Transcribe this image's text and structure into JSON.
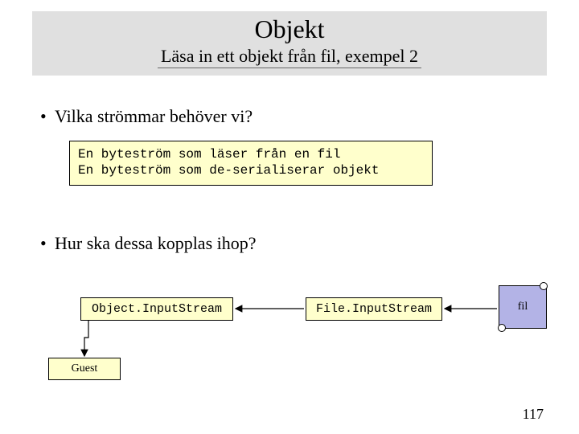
{
  "title": {
    "main": "Objekt",
    "sub": "Läsa in ett objekt från fil, exempel 2"
  },
  "bullets": {
    "b1": "Vilka strömmar behöver vi?",
    "b2": "Hur ska dessa kopplas ihop?"
  },
  "code": {
    "line1": "En byteström som läser från en fil",
    "line2": "En byteström som de-serialiserar objekt"
  },
  "diagram": {
    "ois": "Object.InputStream",
    "fis": "File.InputStream",
    "file": "fil",
    "guest": "Guest"
  },
  "page": "117"
}
